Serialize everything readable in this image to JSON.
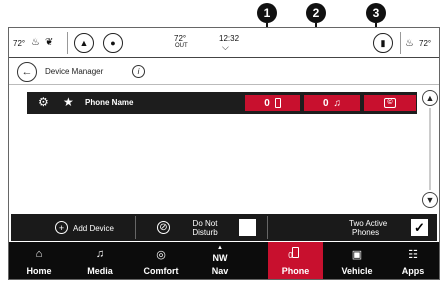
{
  "callouts": [
    "1",
    "2",
    "3"
  ],
  "status": {
    "temp_left": "72°",
    "outside_temp": "72°",
    "outside_label": "OUT",
    "time": "12:32",
    "temp_right": "72°"
  },
  "header": {
    "title": "Device Manager"
  },
  "phone_row": {
    "name": "Phone Name",
    "phone_btn_label": "0",
    "music_btn_label": "0"
  },
  "actions": {
    "add_device": "Add Device",
    "do_not_disturb": [
      "Do Not",
      "Disturb"
    ],
    "two_active": [
      "Two Active",
      "Phones"
    ],
    "two_active_checked": "✓"
  },
  "nav": {
    "items": [
      {
        "label": "Home",
        "icon": "home-icon"
      },
      {
        "label": "Media",
        "icon": "music-note-icon"
      },
      {
        "label": "Comfort",
        "icon": "steering-heat-icon"
      },
      {
        "label": "Nav",
        "icon": "compass-icon",
        "top_text": "NW"
      },
      {
        "label": "Phone",
        "icon": "phone-icon",
        "top_text": "0"
      },
      {
        "label": "Vehicle",
        "icon": "car-icon"
      },
      {
        "label": "Apps",
        "icon": "apps-grid-icon"
      }
    ],
    "active": "Phone"
  },
  "colors": {
    "accent": "#c8102e",
    "bar": "#1a1a1a",
    "nav": "#0c0c0c"
  }
}
